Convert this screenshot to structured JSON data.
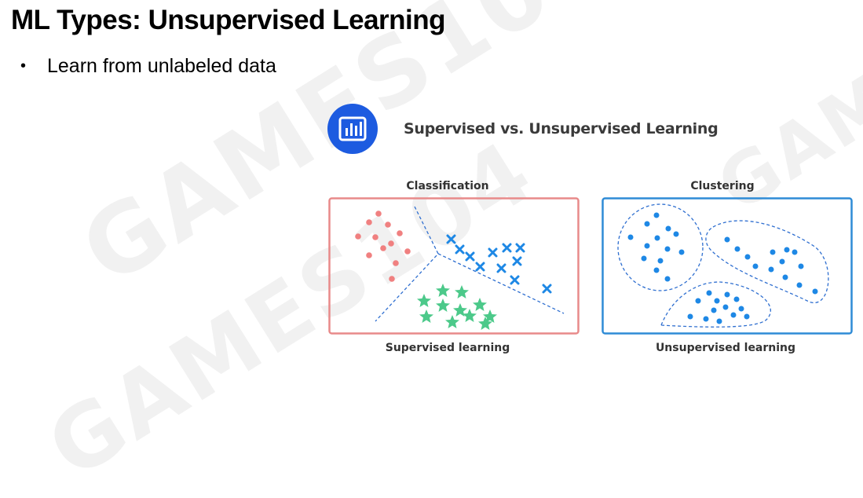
{
  "slide": {
    "title": "ML Types:  Unsupervised Learning",
    "bullets": [
      "Learn from unlabeled data"
    ]
  },
  "figure": {
    "logo_icon": "bar-chart-icon",
    "title": "Supervised vs. Unsupervised Learning",
    "left_panel": {
      "heading": "Classification",
      "caption": "Supervised learning",
      "border_color": "#e88a8a"
    },
    "right_panel": {
      "heading": "Clustering",
      "caption": "Unsupervised learning",
      "border_color": "#2f8bd6"
    },
    "colors": {
      "red_points": "#f08080",
      "blue_points": "#1e88e5",
      "green_points": "#4cc98a",
      "logo_bg": "#1d5be0"
    }
  },
  "watermark": "GAMES104"
}
